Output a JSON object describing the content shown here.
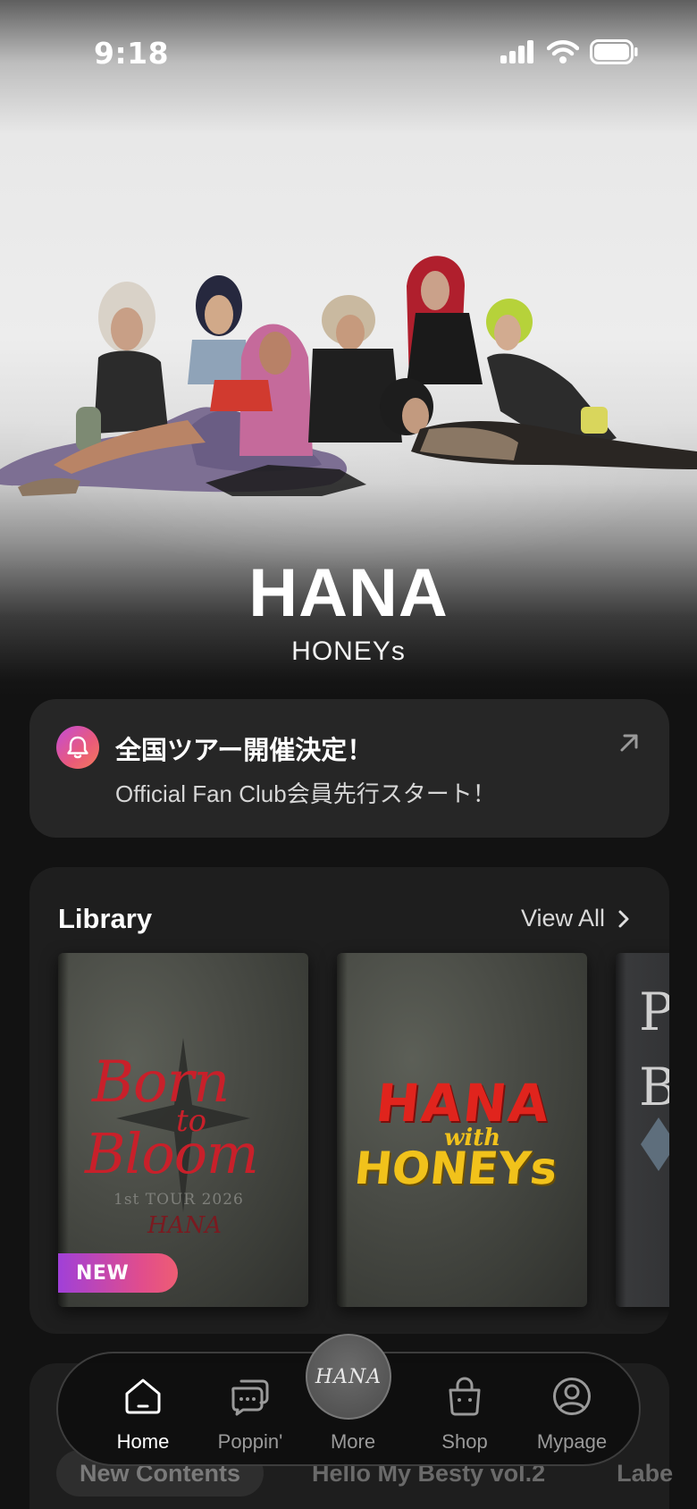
{
  "status_bar": {
    "time": "9:18"
  },
  "hero": {
    "artist_name": "HANA",
    "subtitle": "HONEYs"
  },
  "notice": {
    "title": "全国ツアー開催決定！",
    "text": "Official Fan Club会員先行スタート！"
  },
  "library": {
    "title": "Library",
    "view_all": "View All",
    "items": [
      {
        "cover_line1": "Born",
        "cover_line2": "to",
        "cover_line3": "Bloom",
        "cover_line4": "1st TOUR 2026",
        "cover_line5": "HANA",
        "badge": "NEW"
      },
      {
        "cover_line1": "HANA",
        "cover_line2": "with",
        "cover_line3": "HONEYs"
      },
      {
        "cover_line1": "P",
        "cover_line2": "B"
      }
    ]
  },
  "tabs": [
    "New Contents",
    "Hello My Besty vol.2",
    "Labe"
  ],
  "nav": {
    "items": [
      {
        "label": "Home",
        "icon": "home-icon",
        "active": true
      },
      {
        "label": "Poppin'",
        "icon": "chat-icon"
      },
      {
        "label": "More",
        "icon": "hana-logo"
      },
      {
        "label": "Shop",
        "icon": "bag-icon"
      },
      {
        "label": "Mypage",
        "icon": "user-icon"
      }
    ],
    "center_logo": "HANA"
  },
  "colors": {
    "background": "#121212",
    "card": "#262626",
    "accent_gradient_start": "#a040d8",
    "accent_gradient_end": "#ee5d73",
    "cover_red": "#c8202a",
    "cover_yellow": "#f1c21b"
  }
}
